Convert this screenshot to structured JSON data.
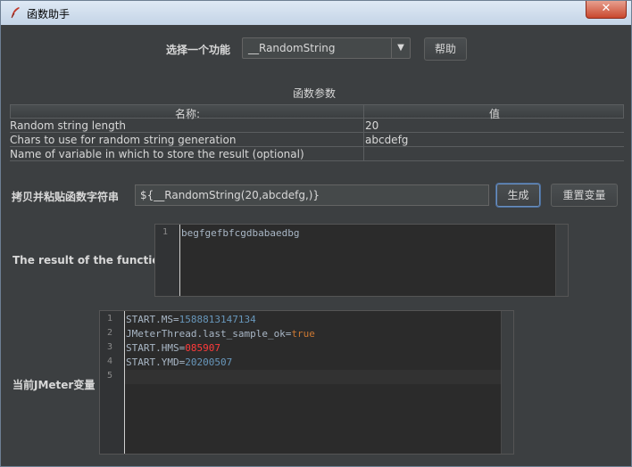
{
  "window": {
    "title": "函数助手",
    "close_label": "✕"
  },
  "selector": {
    "label": "选择一个功能",
    "value": "__RandomString",
    "arrow": "▼",
    "help_label": "帮助"
  },
  "params": {
    "section_title": "函数参数",
    "col_name": "名称:",
    "col_value": "值",
    "rows": [
      {
        "name": "Random string length",
        "value": "20"
      },
      {
        "name": "Chars to use for random string generation",
        "value": "abcdefg"
      },
      {
        "name": "Name of variable in which to store the result (optional)",
        "value": ""
      }
    ]
  },
  "copy": {
    "label": "拷贝并粘贴函数字符串",
    "value": "${__RandomString(20,abcdefg,)}",
    "generate_label": "生成",
    "reset_label": "重置变量"
  },
  "result": {
    "label": "The result of the function is",
    "line_no": "1",
    "text": "begfgefbfcgdbabaedbg"
  },
  "vars": {
    "label": "当前JMeter变量",
    "lines": [
      {
        "no": "1",
        "key": "START.MS=",
        "val": "1588813147134"
      },
      {
        "no": "2",
        "key": "JMeterThread.last_sample_ok=",
        "val": "true"
      },
      {
        "no": "3",
        "key": "START.HMS=",
        "val": "085907"
      },
      {
        "no": "4",
        "key": "START.YMD=",
        "val": "20200507"
      },
      {
        "no": "5",
        "key": "",
        "val": ""
      }
    ]
  },
  "colors": {
    "number": "#6897bb",
    "keyword": "#cc7832",
    "error": "#ff3b3b",
    "background": "#3c3f41"
  }
}
